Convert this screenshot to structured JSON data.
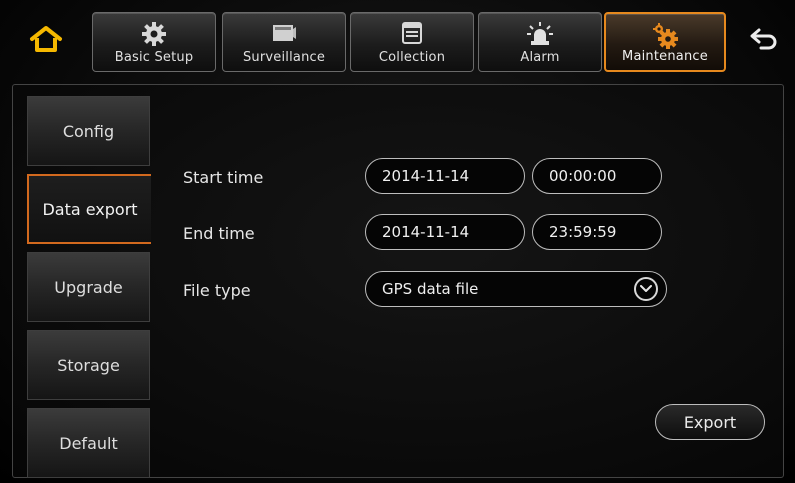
{
  "nav": {
    "home_icon": "home-icon",
    "back_icon": "back-arrow-icon",
    "accent_color": "#e6891e",
    "tabs": [
      {
        "label": "Basic Setup",
        "icon": "gear-icon"
      },
      {
        "label": "Surveillance",
        "icon": "camera-icon"
      },
      {
        "label": "Collection",
        "icon": "document-icon"
      },
      {
        "label": "Alarm",
        "icon": "alarm-light-icon"
      },
      {
        "label": "Maintenance",
        "icon": "gears-icon",
        "active": true
      }
    ]
  },
  "sidebar": {
    "items": [
      {
        "label": "Config"
      },
      {
        "label": "Data export",
        "active": true
      },
      {
        "label": "Upgrade"
      },
      {
        "label": "Storage"
      },
      {
        "label": "Default"
      }
    ]
  },
  "form": {
    "start_time": {
      "label": "Start time",
      "date": "2014-11-14",
      "time": "00:00:00"
    },
    "end_time": {
      "label": "End time",
      "date": "2014-11-14",
      "time": "23:59:59"
    },
    "file_type": {
      "label": "File type",
      "value": "GPS data file"
    }
  },
  "actions": {
    "export_label": "Export"
  }
}
